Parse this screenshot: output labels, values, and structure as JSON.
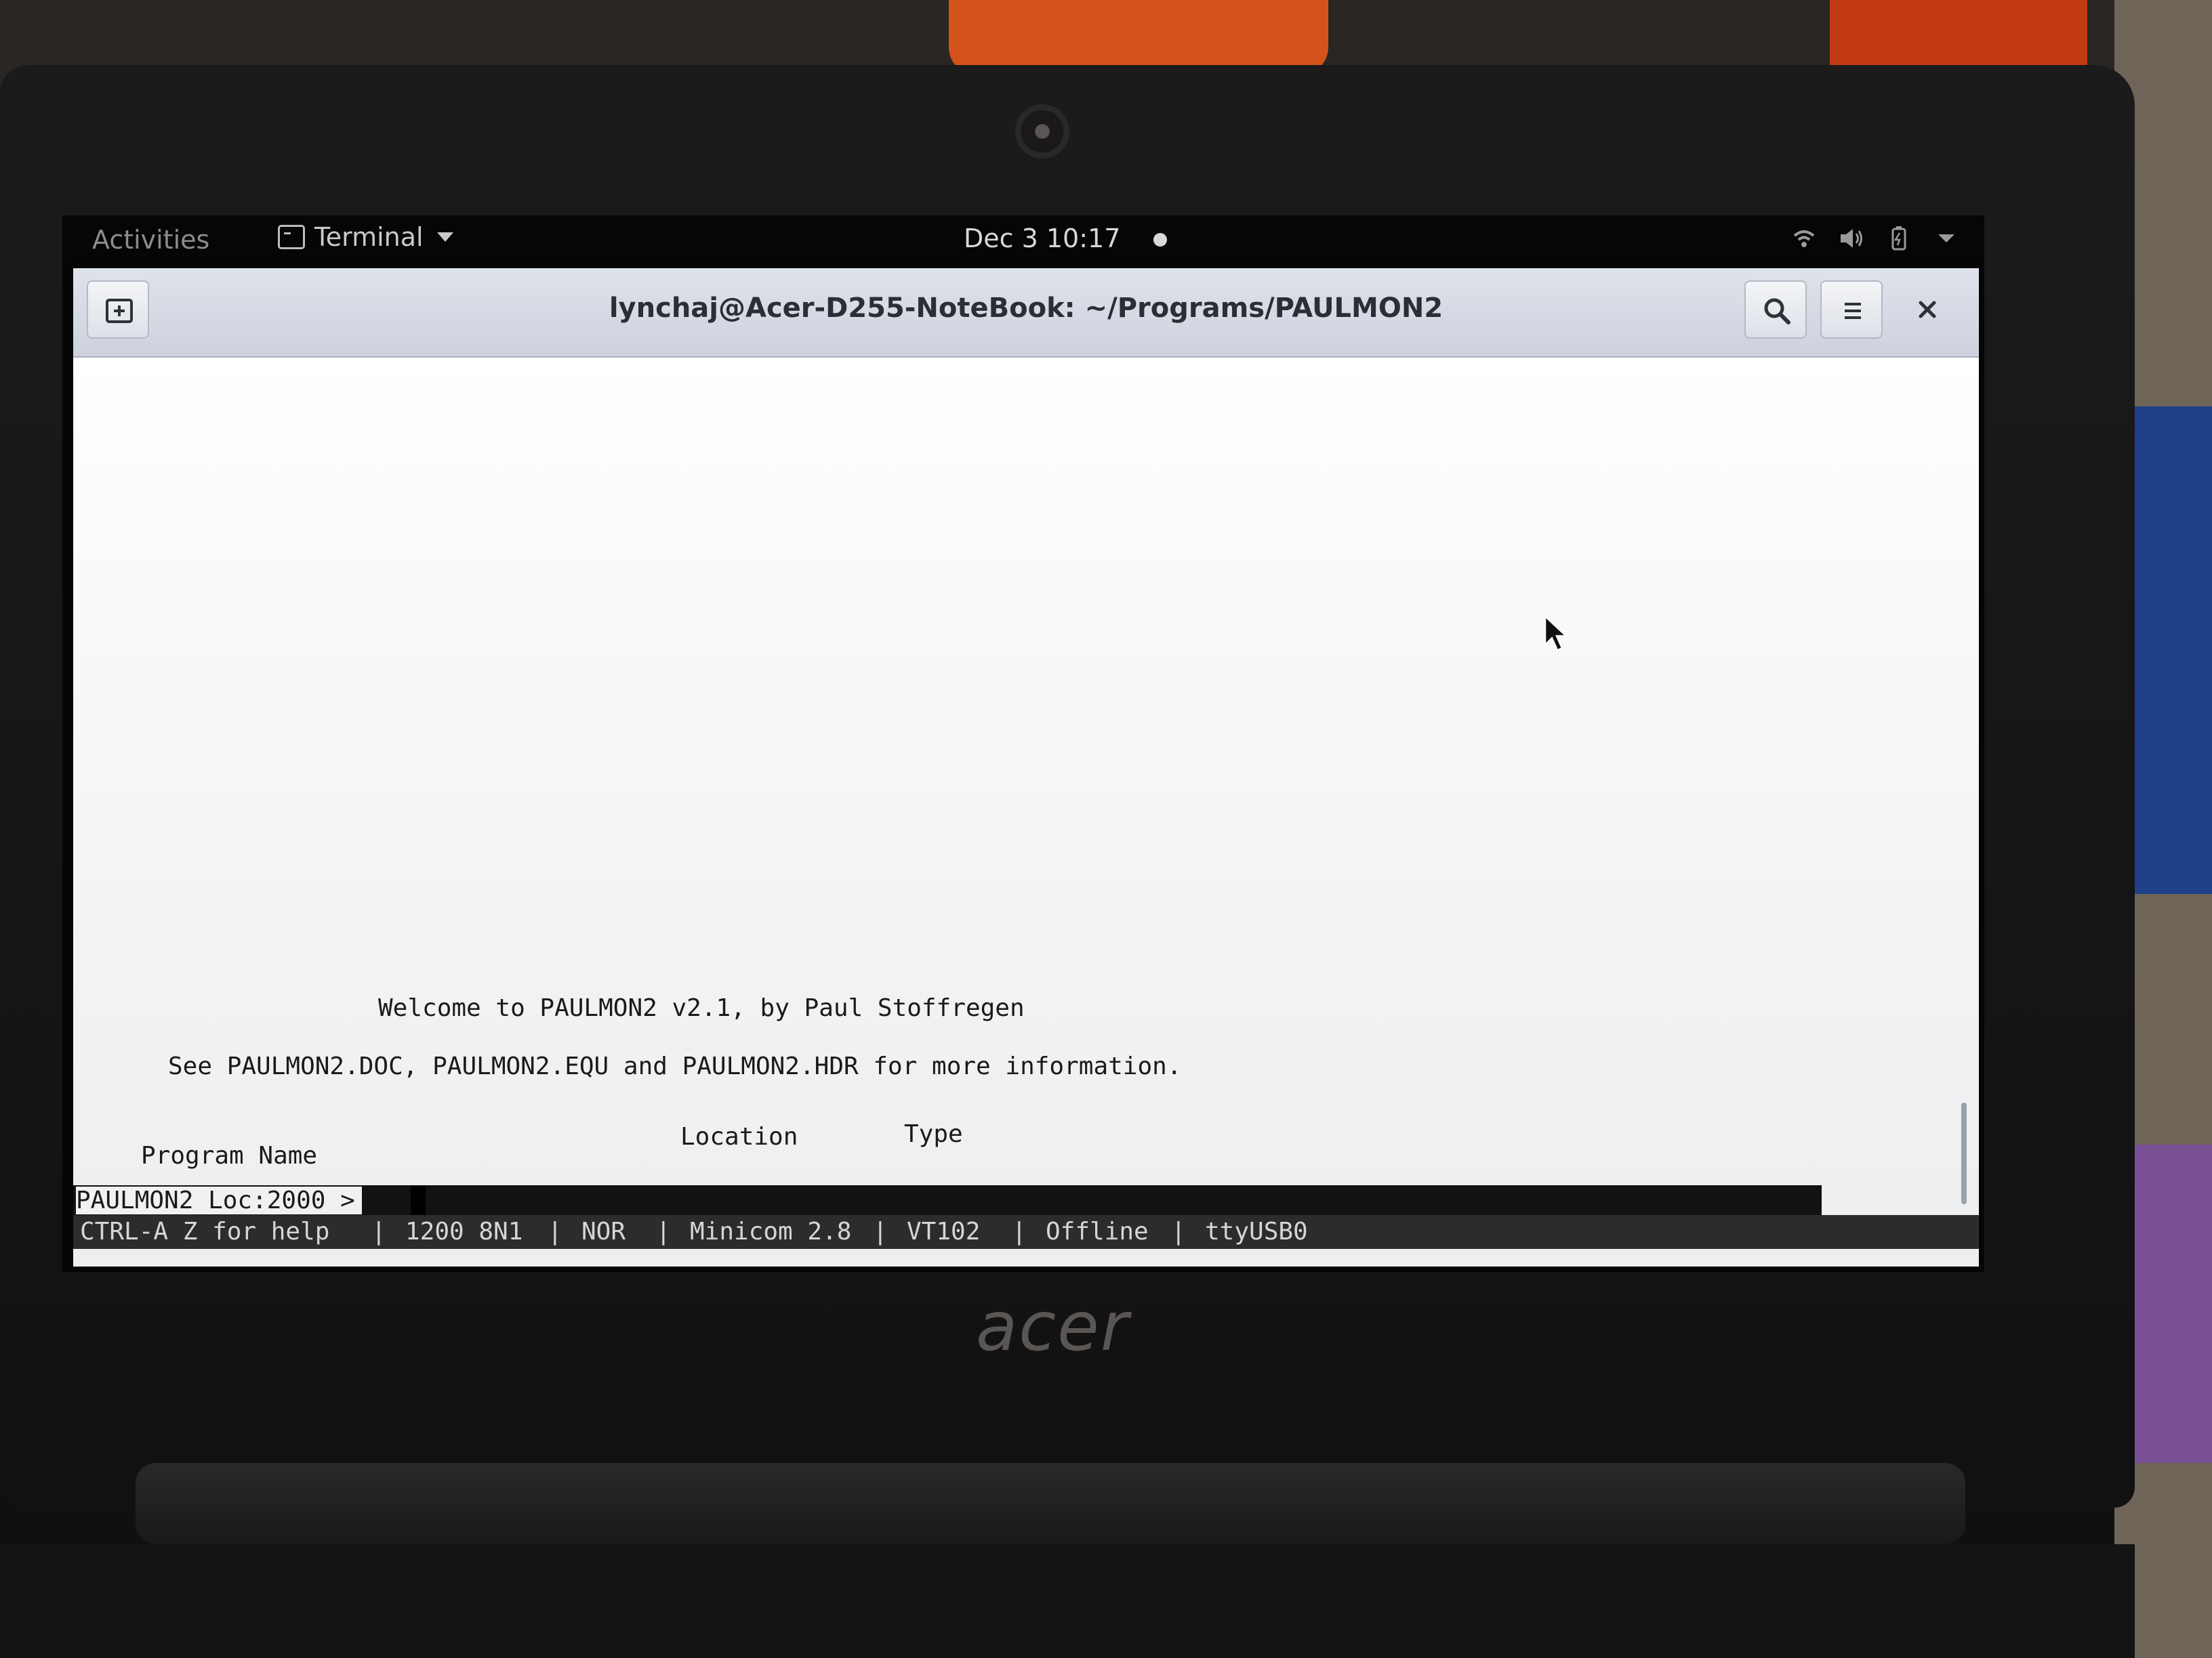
{
  "topbar": {
    "activities": "Activities",
    "app_menu_label": "Terminal",
    "clock": "Dec 3 10:17"
  },
  "window": {
    "title": "lynchaj@Acer-D255-NoteBook: ~/Programs/PAULMON2"
  },
  "terminal": {
    "welcome": "Welcome to PAULMON2 v2.1, by Paul Stoffregen",
    "info": "See PAULMON2.DOC, PAULMON2.EQU and PAULMON2.HDR for more information.",
    "columns": {
      "program_name": "Program Name",
      "location": "Location",
      "type": "Type"
    },
    "prompt": "PAULMON2 Loc:2000 >"
  },
  "minicom_status": {
    "help": "CTRL-A Z for help",
    "serial": "1200 8N1",
    "mode": "NOR",
    "version": "Minicom 2.8",
    "terminal_type": "VT102",
    "connection": "Offline",
    "port": "ttyUSB0",
    "separator": "|"
  },
  "laptop": {
    "brand": "acer"
  },
  "icons": {
    "new_tab": "new-tab-icon",
    "search": "search-icon",
    "menu": "hamburger-menu-icon",
    "close": "close-icon",
    "pointer": "mouse-pointer-icon"
  }
}
